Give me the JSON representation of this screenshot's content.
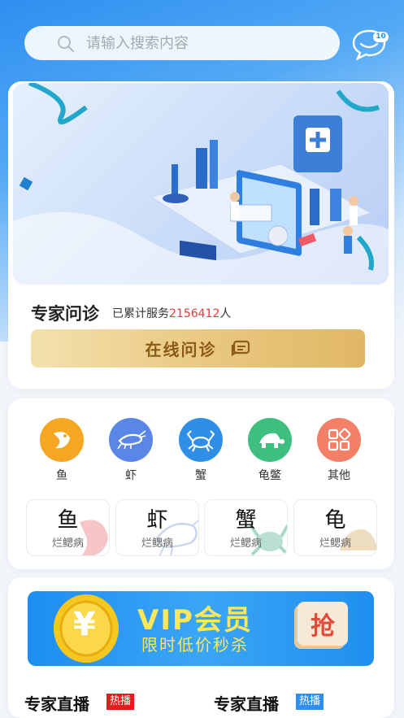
{
  "search": {
    "placeholder": "请输入搜索内容"
  },
  "messages": {
    "badge": "10"
  },
  "consult": {
    "title": "专家问诊",
    "served_prefix": "已累计服务",
    "served_count": "2156412",
    "served_suffix": "人",
    "button_label": "在线问诊"
  },
  "categories": [
    {
      "label": "鱼",
      "icon": "fish-icon",
      "color": "#f5a623"
    },
    {
      "label": "虾",
      "icon": "shrimp-icon",
      "color": "#5a86e8"
    },
    {
      "label": "蟹",
      "icon": "crab-icon",
      "color": "#2f8fe6"
    },
    {
      "label": "龟鳖",
      "icon": "turtle-icon",
      "color": "#3fbf7f"
    },
    {
      "label": "其他",
      "icon": "grid-icon",
      "color": "#f37f66"
    }
  ],
  "diseases": [
    {
      "name": "鱼",
      "disease": "烂鳃病"
    },
    {
      "name": "虾",
      "disease": "烂鳃病"
    },
    {
      "name": "蟹",
      "disease": "烂鳃病"
    },
    {
      "name": "龟",
      "disease": "烂鳃病"
    }
  ],
  "vip": {
    "title": "VIP会员",
    "subtitle": "限时低价秒杀",
    "grab_label": "抢",
    "coin_symbol": "¥"
  },
  "live": [
    {
      "title": "专家直播",
      "tag": "热播",
      "tag_color": "#e21b1b"
    },
    {
      "title": "专家直播",
      "tag": "热播",
      "tag_color": "#2e8ff0"
    }
  ]
}
